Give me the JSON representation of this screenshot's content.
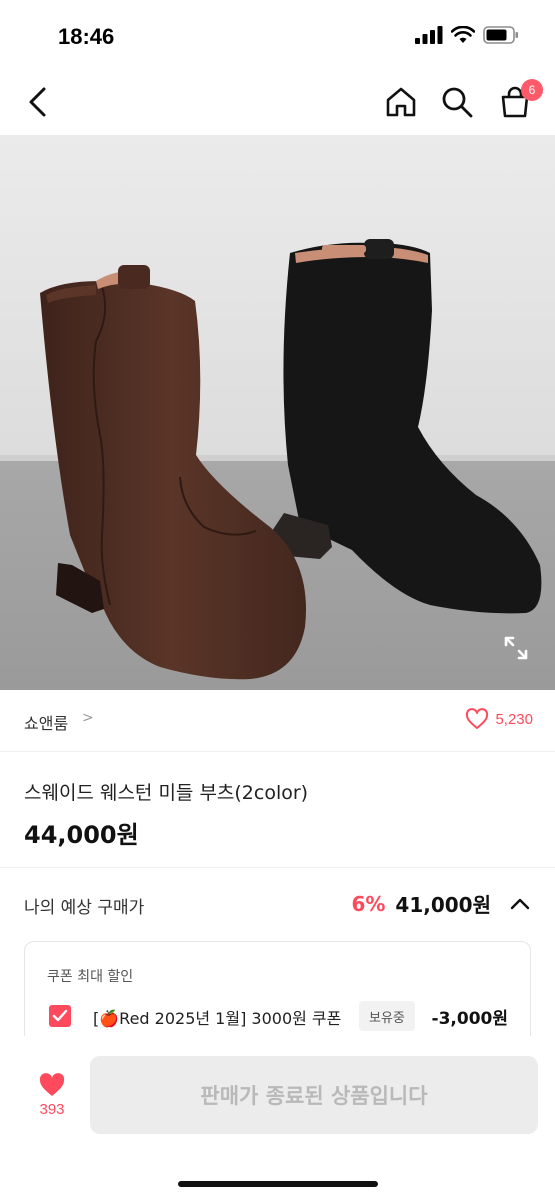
{
  "status_bar": {
    "time": "18:46"
  },
  "nav": {
    "cart_count": "6"
  },
  "brand": {
    "name": "쇼앤룸",
    "chevron": ">",
    "like_count": "5,230"
  },
  "product": {
    "title": "스웨이드 웨스턴 미들 부츠(2color)",
    "price": "44,000원"
  },
  "estimate": {
    "label": "나의 예상 구매가",
    "discount": "6%",
    "price": "41,000원"
  },
  "coupon": {
    "title": "쿠폰 최대 할인",
    "name": "[🍎Red 2025년 1월] 3000원 쿠폰",
    "badge": "보유중",
    "amount": "-3,000원"
  },
  "bottom": {
    "wish_count": "393",
    "cta_label": "판매가 종료된 상품입니다"
  },
  "colors": {
    "accent": "#ff4a5d",
    "brown_boot": "#4a2a20",
    "black_boot": "#161616"
  },
  "icons": [
    "chevron-left-icon",
    "home-icon",
    "search-icon",
    "shopping-bag-icon",
    "expand-icon",
    "heart-outline-icon",
    "check-icon",
    "chevron-up-icon",
    "heart-filled-icon"
  ]
}
